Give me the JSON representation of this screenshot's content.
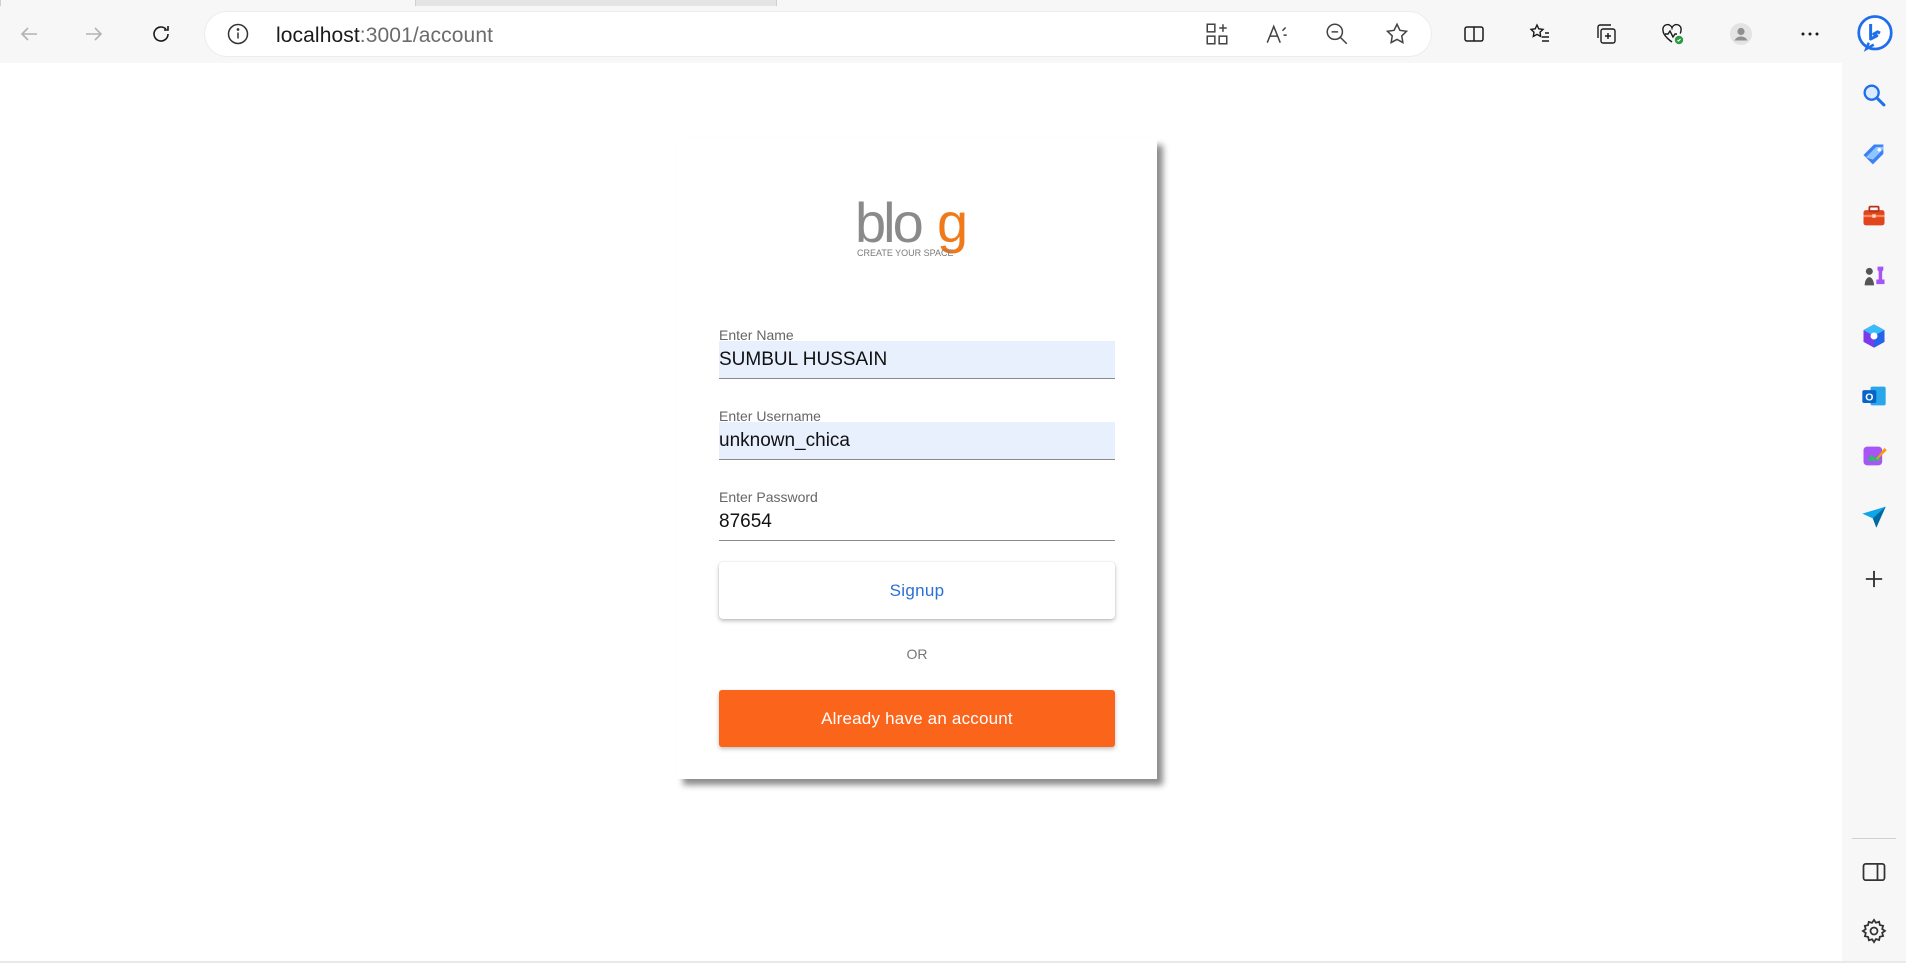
{
  "browser": {
    "url_host": "localhost",
    "url_rest": ":3001/account"
  },
  "logo": {
    "wordmark_left": "blo",
    "wordmark_right": "g",
    "tagline": "CREATE YOUR SPACE"
  },
  "form": {
    "name_label": "Enter Name",
    "name_value": "SUMBUL HUSSAIN",
    "username_label": "Enter Username",
    "username_value": "unknown_chica",
    "password_label": "Enter Password",
    "password_value": "87654",
    "signup_label": "Signup",
    "or_label": "OR",
    "login_label": "Already have an account"
  },
  "colors": {
    "accent_orange": "#fb641b",
    "link_blue": "#2a6fd6",
    "autofill_bg": "#e8f0fe"
  }
}
